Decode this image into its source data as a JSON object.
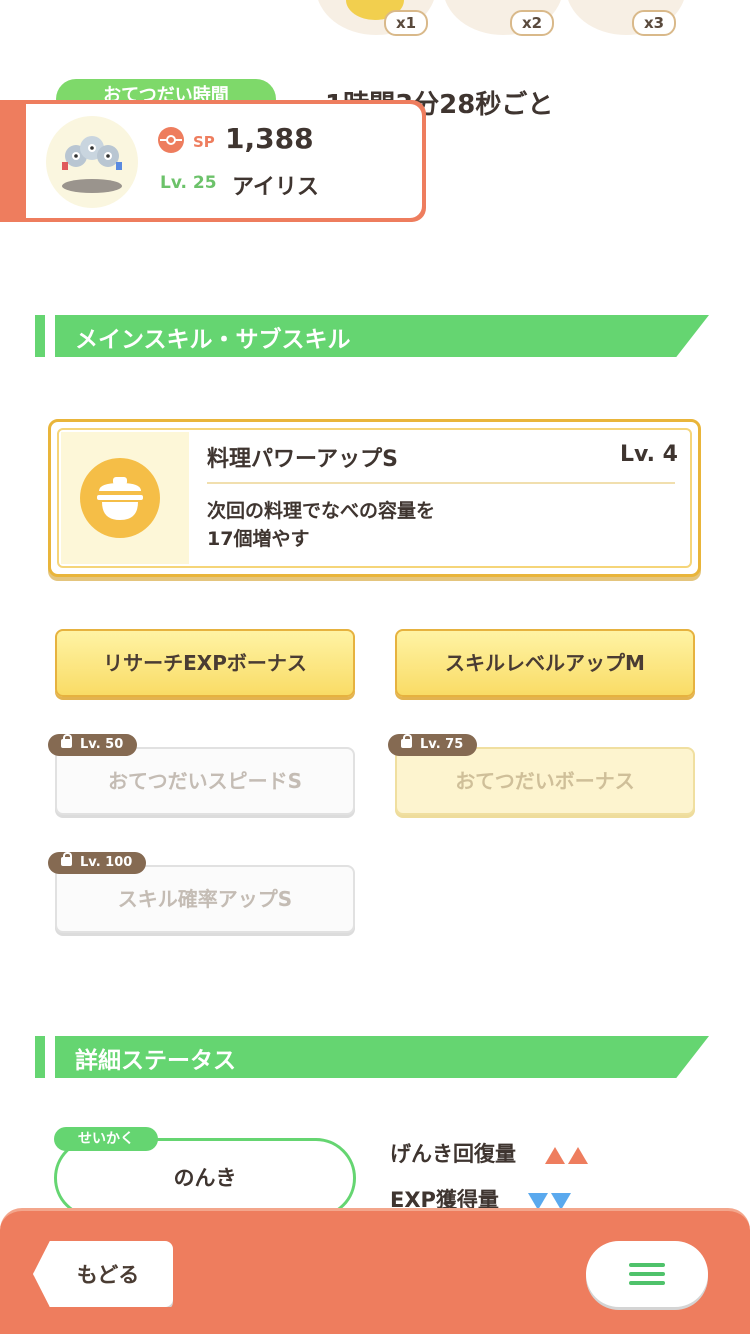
{
  "top": {
    "counts": [
      "x1",
      "x2",
      "x3"
    ]
  },
  "helper": {
    "label": "おてつだい時間",
    "time": "1時間3分28秒ごと"
  },
  "profile": {
    "sp_label": "SP",
    "sp_value": "1,388",
    "level": "Lv. 25",
    "name": "アイリス"
  },
  "skills_section": {
    "title": "メインスキル・サブスキル",
    "main_skill": {
      "name": "料理パワーアップS",
      "level": "Lv. 4",
      "description_line1": "次回の料理でなべの容量を",
      "description_line2": "17個増やす"
    },
    "sub_skills": [
      {
        "label": "リサーチEXPボーナス",
        "locked": false
      },
      {
        "label": "スキルレベルアップM",
        "locked": false
      },
      {
        "label": "おてつだいスピードS",
        "locked": true,
        "unlock_level": "Lv. 50"
      },
      {
        "label": "おてつだいボーナス",
        "locked": true,
        "unlock_level": "Lv. 75"
      },
      {
        "label": "スキル確率アップS",
        "locked": true,
        "unlock_level": "Lv. 100"
      }
    ]
  },
  "status_section": {
    "title": "詳細ステータス",
    "nature_tag": "せいかく",
    "nature": "のんき",
    "stat_up": "げんき回復量",
    "stat_down": "EXP獲得量"
  },
  "bottom_bar": {
    "back_label": "もどる"
  },
  "colors": {
    "accent_green": "#65d571",
    "accent_orange": "#ee7d5e",
    "skill_gold": "#e9b53a",
    "down_blue": "#5aa9ee"
  },
  "icons": [
    "pokeball-icon",
    "pot-icon",
    "lock-icon",
    "menu-icon"
  ]
}
